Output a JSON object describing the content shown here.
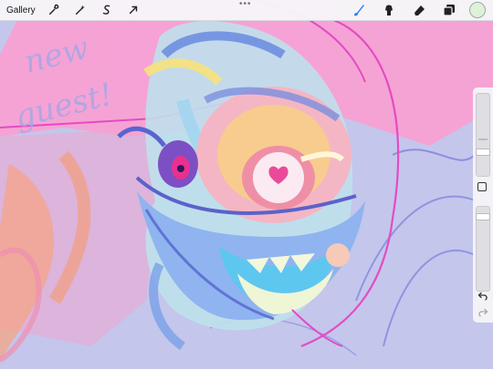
{
  "toolbar": {
    "gallery_label": "Gallery",
    "left_tools": [
      {
        "name": "actions-wrench-icon"
      },
      {
        "name": "adjustments-magic-wand-icon"
      },
      {
        "name": "selection-s-icon"
      },
      {
        "name": "transform-arrow-icon"
      }
    ],
    "handle": "•••",
    "right_tools": [
      {
        "name": "brush-icon",
        "active_color": "#2f7ef6"
      },
      {
        "name": "smudge-icon"
      },
      {
        "name": "eraser-icon"
      },
      {
        "name": "layers-icon"
      }
    ],
    "current_color": "#dff1d8"
  },
  "canvas": {
    "sketch_text": "new guest!"
  },
  "sidebar": {
    "brush_size_level": 0.21,
    "opacity_level": 0.04
  },
  "colors": {
    "canvas_bg": "#c4c6ec",
    "pink": "#f5a3d4",
    "magenta": "#e44bc3",
    "blue": "#6d87d9"
  }
}
